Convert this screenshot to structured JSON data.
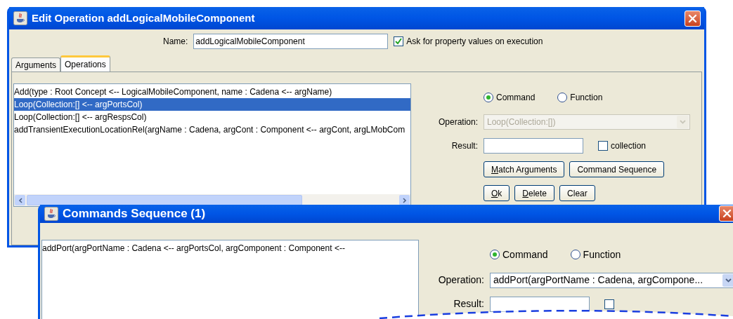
{
  "edit_window": {
    "title": "Edit Operation addLogicalMobileComponent",
    "name_label": "Name:",
    "name_value": "addLogicalMobileComponent",
    "ask_checkbox": {
      "label": "Ask for property values on execution",
      "checked": true
    },
    "tabs": [
      {
        "label": "Arguments",
        "selected": false
      },
      {
        "label": "Operations",
        "selected": true
      }
    ],
    "operations": [
      {
        "text": "Add(type : Root Concept <-- LogicalMobileComponent, name : Cadena <-- argName)",
        "selected": false
      },
      {
        "text": "Loop(Collection:[] <-- argPortsCol)",
        "selected": true
      },
      {
        "text": "Loop(Collection:[] <-- argRespsCol)",
        "selected": false
      },
      {
        "text": "addTransientExecutionLocationRel(argName : Cadena, argCont : Component <-- argCont, argLMobCom",
        "selected": false
      }
    ],
    "mode_options": [
      {
        "label": "Command",
        "selected": true
      },
      {
        "label": "Function",
        "selected": false
      }
    ],
    "operation": {
      "label": "Operation:",
      "value": "Loop(Collection:[])",
      "disabled": true
    },
    "result": {
      "label": "Result:"
    },
    "collection": {
      "label": "collection",
      "checked": false
    },
    "button_rows": [
      {
        "buttons": [
          {
            "label": "Match Arguments",
            "mnemonic": true
          },
          {
            "label": "Command Sequence",
            "mnemonic": false
          }
        ]
      },
      {
        "buttons": [
          {
            "label": "Ok",
            "mnemonic": true
          },
          {
            "label": "Delete",
            "mnemonic": true
          },
          {
            "label": "Clear",
            "mnemonic": false
          }
        ]
      }
    ]
  },
  "sequence_window": {
    "title": "Commands Sequence (1)",
    "commands": [
      {
        "text": "addPort(argPortName : Cadena <-- argPortsCol, argComponent : Component <--",
        "selected": false
      }
    ],
    "mode_options": [
      {
        "label": "Command",
        "selected": true
      },
      {
        "label": "Function",
        "selected": false
      }
    ],
    "operation": {
      "label": "Operation:",
      "value": "addPort(argPortName : Cadena, argCompone...",
      "disabled": false
    },
    "result": {
      "label": "Result:"
    },
    "collection": {
      "checked": false
    }
  }
}
